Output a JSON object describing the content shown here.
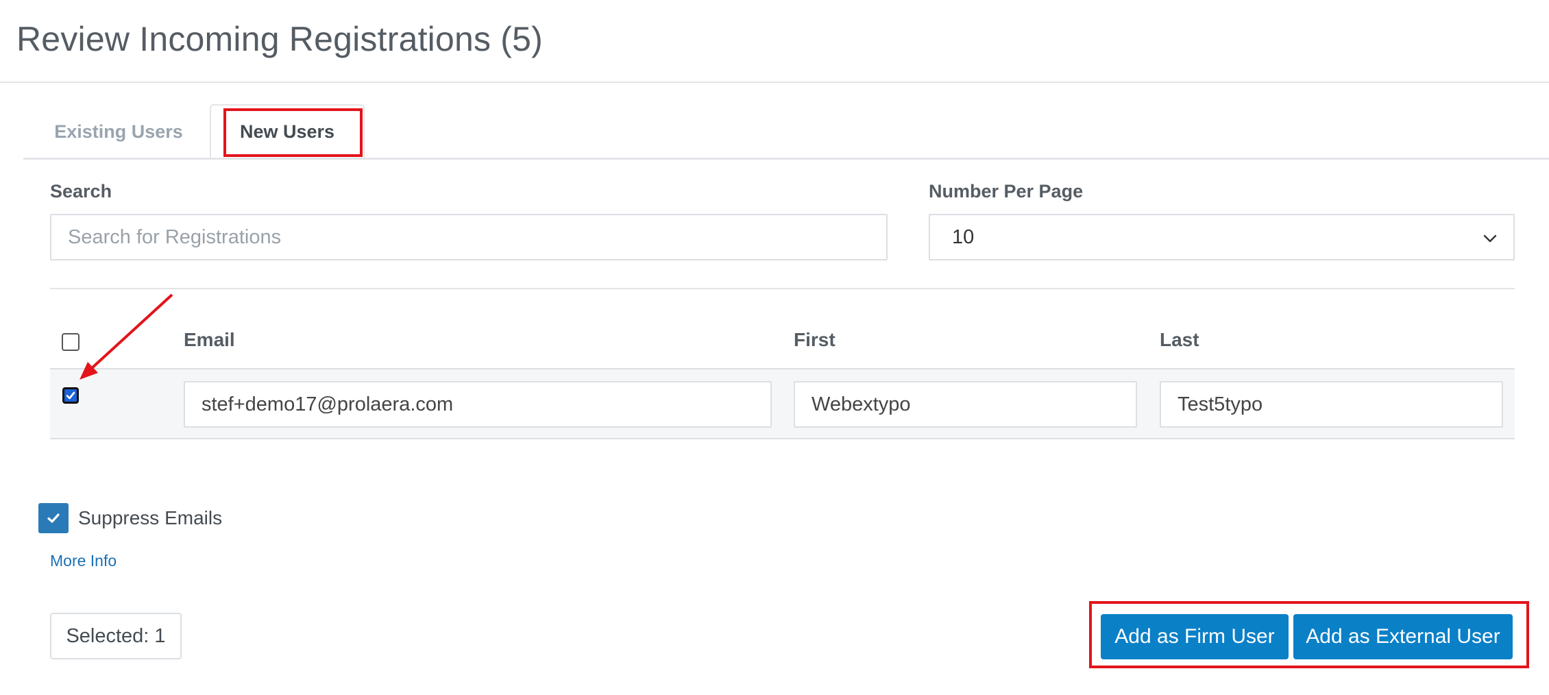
{
  "page": {
    "title": "Review Incoming Registrations (5)"
  },
  "tabs": [
    {
      "label": "Existing Users",
      "active": false
    },
    {
      "label": "New Users",
      "active": true
    }
  ],
  "search": {
    "label": "Search",
    "placeholder": "Search for Registrations",
    "value": ""
  },
  "per_page": {
    "label": "Number Per Page",
    "value": "10"
  },
  "table": {
    "columns": [
      "Email",
      "First",
      "Last"
    ],
    "rows": [
      {
        "selected": true,
        "email": "stef+demo17@prolaera.com",
        "first": "Webextypo",
        "last": "Test5typo"
      }
    ]
  },
  "suppress_emails": {
    "label": "Suppress Emails",
    "checked": true
  },
  "more_info": {
    "label": "More Info"
  },
  "selected_count": {
    "text": "Selected: 1"
  },
  "actions": {
    "add_firm_user": "Add as Firm User",
    "add_external_user": "Add as External User"
  },
  "colors": {
    "primary_button": "#0a80c7",
    "highlight": "#e3141b",
    "link": "#1a6fb5"
  }
}
